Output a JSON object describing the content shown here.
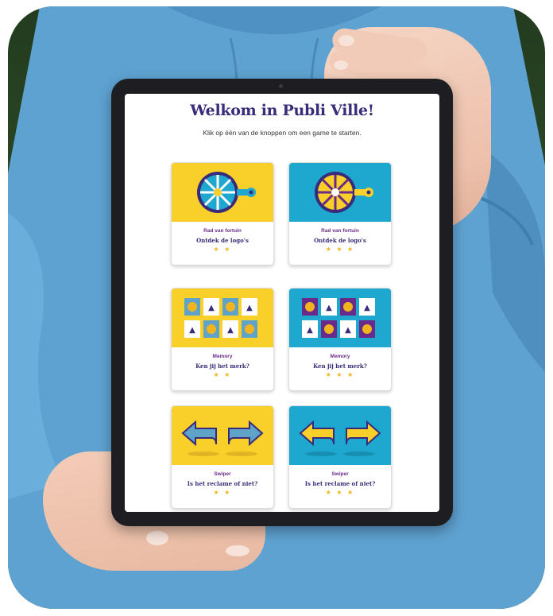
{
  "page": {
    "title": "Welkom in Publi Ville!",
    "subtitle": "Klik op één van de knoppen om een game te starten."
  },
  "games": [
    {
      "name": "Rad van fortuin",
      "description": "Ontdek de logo's",
      "stars": "★ ★",
      "rating": 2,
      "background": "#f9cf2a",
      "icon": "wheel-of-fortune-icon"
    },
    {
      "name": "Rad van fortuin",
      "description": "Ontdek de logo's",
      "stars": "★ ★ ★",
      "rating": 3,
      "background": "#1ea7cf",
      "icon": "wheel-of-fortune-icon"
    },
    {
      "name": "Memory",
      "description": "Ken jij het merk?",
      "stars": "★ ★",
      "rating": 2,
      "background": "#f9cf2a",
      "icon": "memory-cards-icon"
    },
    {
      "name": "Memory",
      "description": "Ken jij het merk?",
      "stars": "★ ★ ★",
      "rating": 3,
      "background": "#1ea7cf",
      "icon": "memory-cards-icon"
    },
    {
      "name": "Swiper",
      "description": "Is het reclame of niet?",
      "stars": "★ ★",
      "rating": 2,
      "background": "#f9cf2a",
      "icon": "swipe-arrows-icon"
    },
    {
      "name": "Swiper",
      "description": "Is het reclame of niet?",
      "stars": "★ ★ ★",
      "rating": 3,
      "background": "#1ea7cf",
      "icon": "swipe-arrows-icon"
    }
  ],
  "colors": {
    "title": "#3a2a7a",
    "accent_purple": "#6a2a8a",
    "star": "#f2b41e",
    "yellow": "#f9cf2a",
    "cyan": "#1ea7cf",
    "sweater": "#5fa3d2"
  }
}
